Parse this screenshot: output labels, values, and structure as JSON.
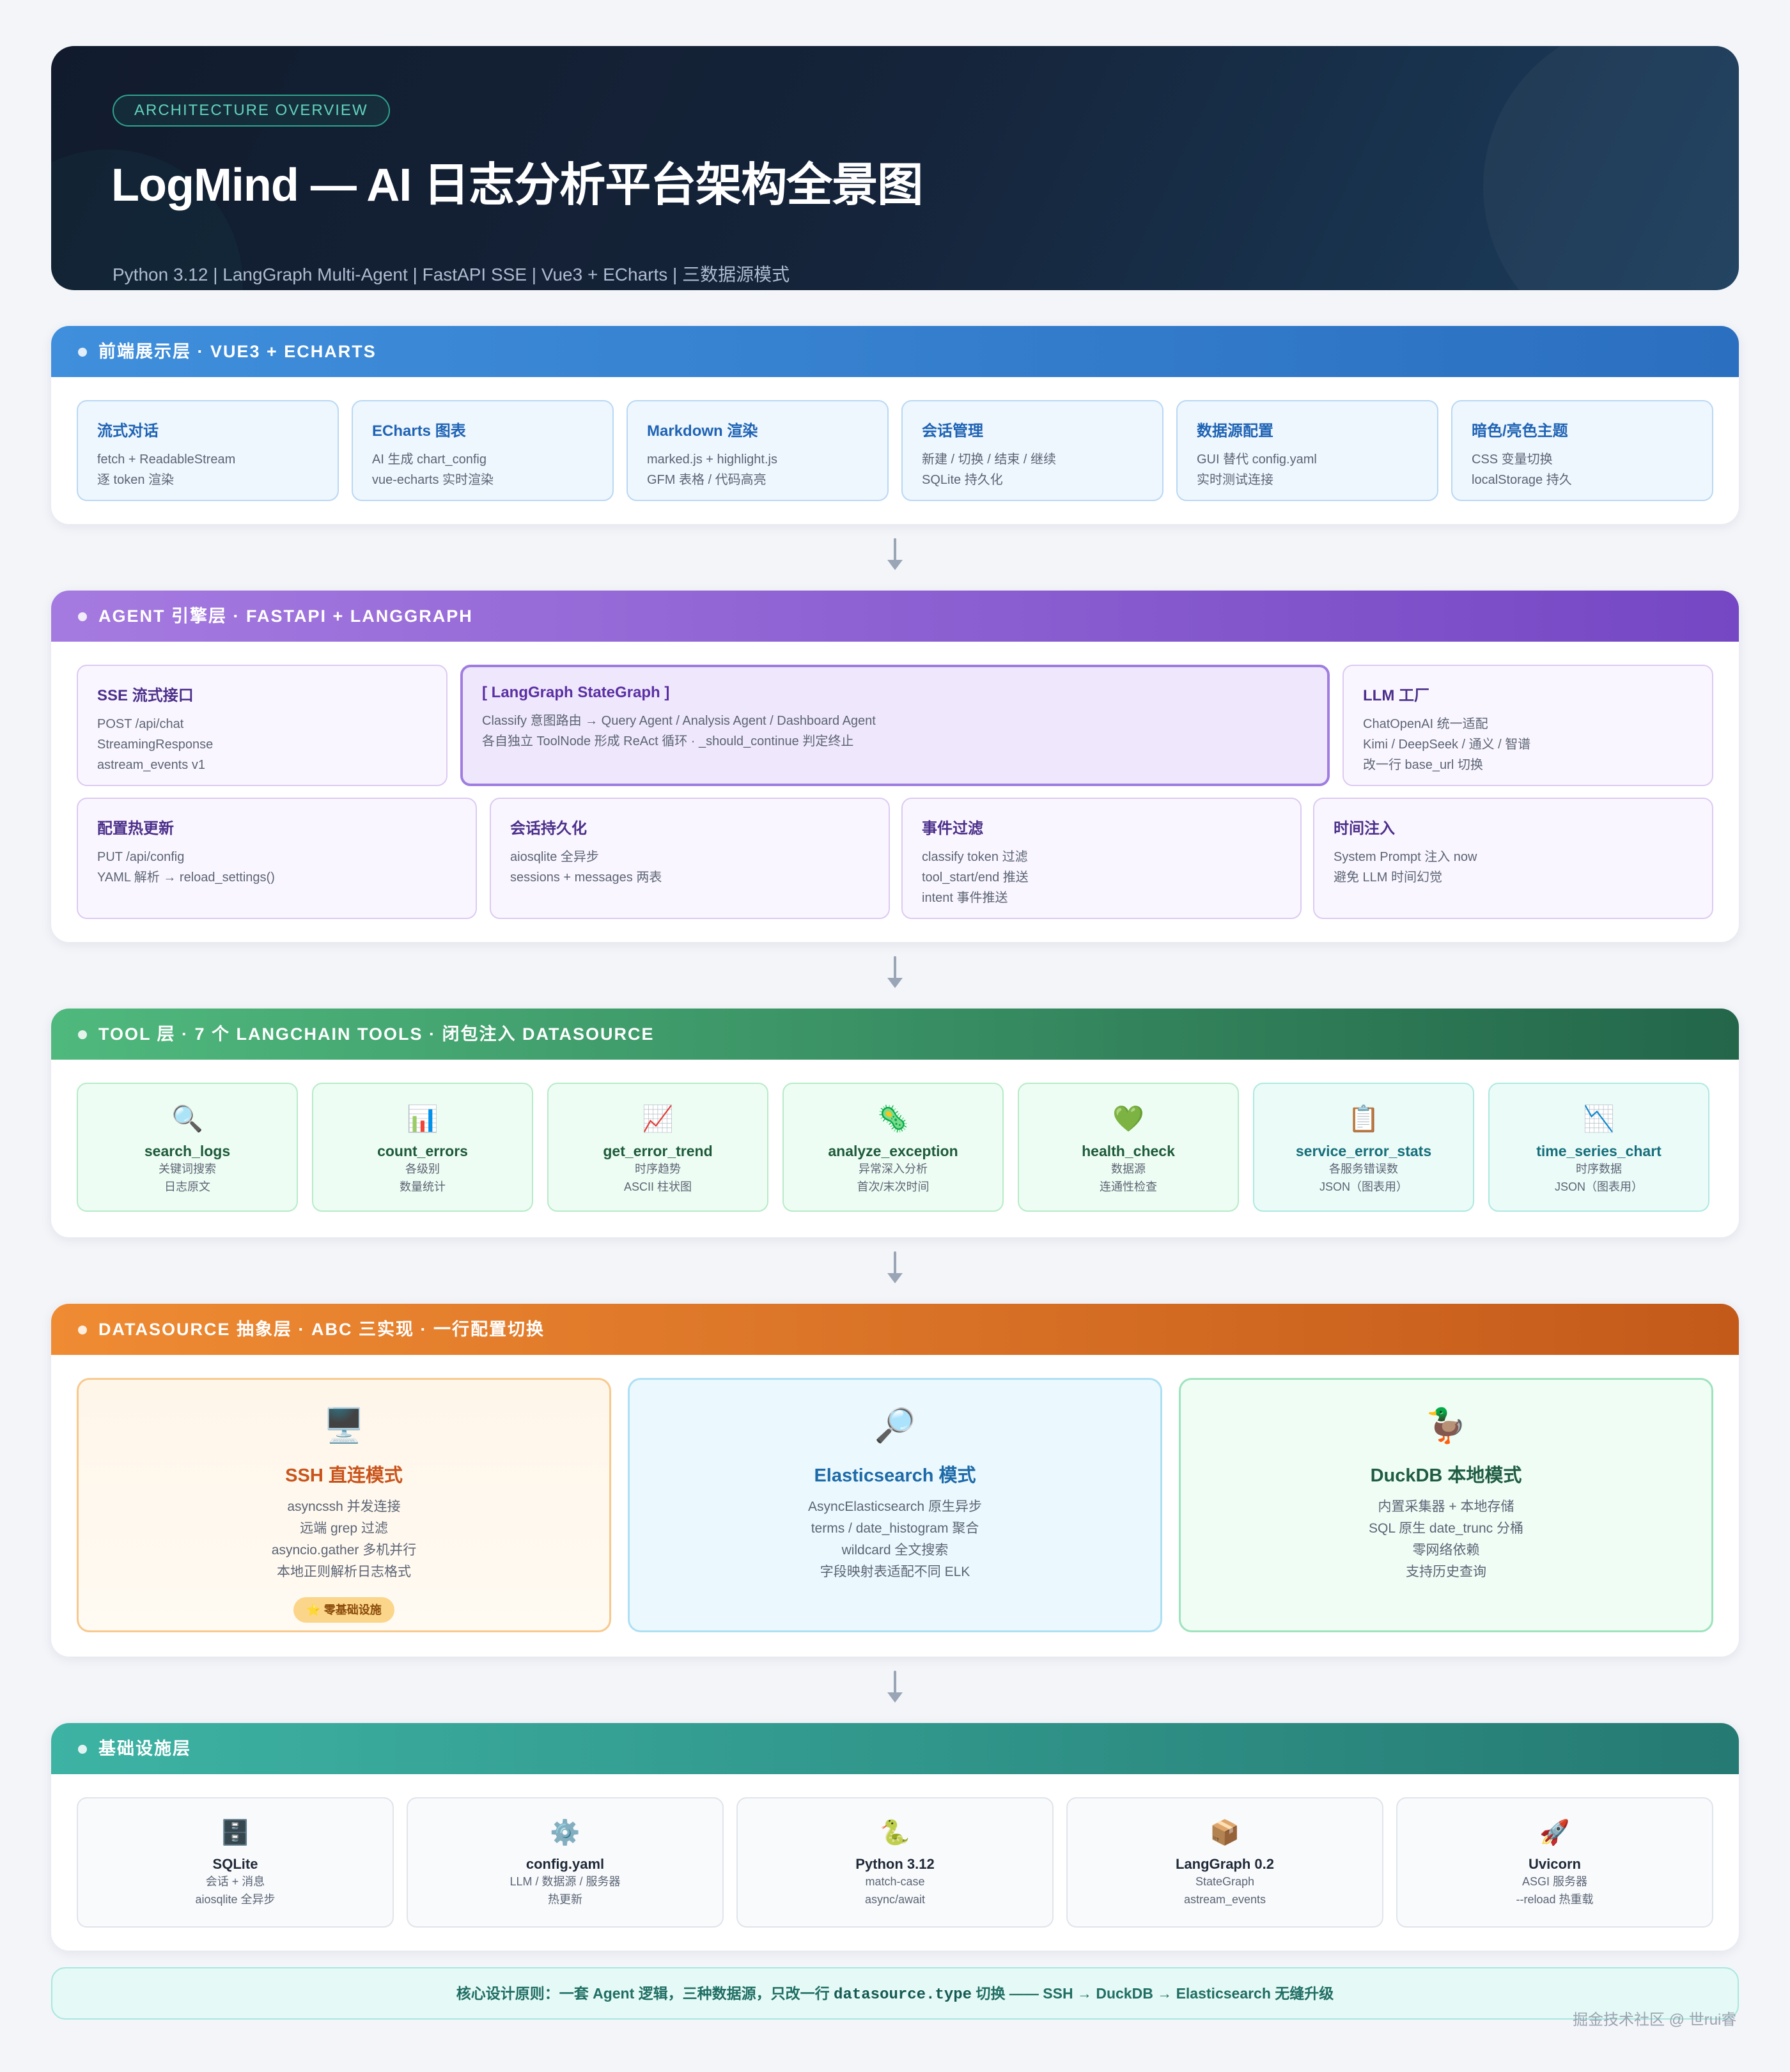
{
  "hero": {
    "badge": "ARCHITECTURE OVERVIEW",
    "title": "LogMind — AI 日志分析平台架构全景图",
    "subtitle": "Python 3.12  |  LangGraph Multi-Agent  |  FastAPI SSE  |  Vue3 + ECharts  |  三数据源模式"
  },
  "frontend": {
    "header": "前端展示层 · VUE3 + ECHARTS",
    "boxes": [
      {
        "title": "流式对话",
        "lines": [
          "fetch + ReadableStream",
          "逐 token 渲染"
        ]
      },
      {
        "title": "ECharts 图表",
        "lines": [
          "AI 生成 chart_config",
          "vue-echarts 实时渲染"
        ]
      },
      {
        "title": "Markdown 渲染",
        "lines": [
          "marked.js + highlight.js",
          "GFM 表格 / 代码高亮"
        ]
      },
      {
        "title": "会话管理",
        "lines": [
          "新建 / 切换 / 结束 / 继续",
          "SQLite 持久化"
        ]
      },
      {
        "title": "数据源配置",
        "lines": [
          "GUI 替代 config.yaml",
          "实时测试连接"
        ]
      },
      {
        "title": "暗色/亮色主题",
        "lines": [
          "CSS 变量切换",
          "localStorage 持久"
        ]
      }
    ]
  },
  "agent": {
    "header": "AGENT 引擎层 · FASTAPI + LANGGRAPH",
    "top": [
      {
        "title": "SSE 流式接口",
        "lines": [
          "POST /api/chat",
          "StreamingResponse",
          "astream_events v1"
        ]
      },
      {
        "title": "[ LangGraph StateGraph ]",
        "lines": [
          "Classify 意图路由 → Query Agent / Analysis Agent / Dashboard Agent",
          "各自独立 ToolNode 形成 ReAct 循环 · _should_continue 判定终止"
        ]
      },
      {
        "title": "LLM 工厂",
        "lines": [
          "ChatOpenAI 统一适配",
          "Kimi / DeepSeek / 通义 / 智谱",
          "改一行 base_url 切换"
        ]
      }
    ],
    "bottom": [
      {
        "title": "配置热更新",
        "lines": [
          "PUT /api/config",
          "YAML 解析 → reload_settings()"
        ]
      },
      {
        "title": "会话持久化",
        "lines": [
          "aiosqlite 全异步",
          "sessions + messages 两表"
        ]
      },
      {
        "title": "事件过滤",
        "lines": [
          "classify token 过滤",
          "tool_start/end 推送",
          "intent 事件推送"
        ]
      },
      {
        "title": "时间注入",
        "lines": [
          "System Prompt 注入 now",
          "避免 LLM 时间幻觉"
        ]
      }
    ]
  },
  "tools": {
    "header": "TOOL 层 · 7 个 LANGCHAIN TOOLS · 闭包注入 DATASOURCE",
    "items": [
      {
        "icon": "🔍",
        "icon_name": "magnifier-icon",
        "name": "search_logs",
        "lines": [
          "关键词搜索",
          "日志原文"
        ]
      },
      {
        "icon": "📊",
        "icon_name": "bar-chart-icon",
        "name": "count_errors",
        "lines": [
          "各级别",
          "数量统计"
        ]
      },
      {
        "icon": "📈",
        "icon_name": "trend-up-icon",
        "name": "get_error_trend",
        "lines": [
          "时序趋势",
          "ASCII 柱状图"
        ]
      },
      {
        "icon": "🦠",
        "icon_name": "microbe-icon",
        "name": "analyze_exception",
        "lines": [
          "异常深入分析",
          "首次/末次时间"
        ]
      },
      {
        "icon": "💚",
        "icon_name": "green-heart-icon",
        "name": "health_check",
        "lines": [
          "数据源",
          "连通性检查"
        ]
      },
      {
        "icon": "📋",
        "icon_name": "clipboard-icon",
        "name": "service_error_stats",
        "lines": [
          "各服务错误数",
          "JSON（图表用）"
        ]
      },
      {
        "icon": "📉",
        "icon_name": "trend-down-icon",
        "name": "time_series_chart",
        "lines": [
          "时序数据",
          "JSON（图表用）"
        ]
      }
    ]
  },
  "datasource": {
    "header": "DATASOURCE 抽象层 · ABC 三实现 · 一行配置切换",
    "items": [
      {
        "icon": "🖥️",
        "icon_name": "desktop-computer-icon",
        "name": "SSH 直连模式",
        "lines": [
          "asyncssh 并发连接",
          "远端 grep 过滤",
          "asyncio.gather 多机并行",
          "本地正则解析日志格式"
        ],
        "badge": "⭐ 零基础设施"
      },
      {
        "icon": "🔎",
        "icon_name": "magnifier-icon",
        "name": "Elasticsearch 模式",
        "lines": [
          "AsyncElasticsearch 原生异步",
          "terms / date_histogram 聚合",
          "wildcard 全文搜索",
          "字段映射表适配不同 ELK"
        ]
      },
      {
        "icon": "🦆",
        "icon_name": "duck-icon",
        "name": "DuckDB 本地模式",
        "lines": [
          "内置采集器 + 本地存储",
          "SQL 原生 date_trunc 分桶",
          "零网络依赖",
          "支持历史查询"
        ]
      }
    ]
  },
  "infra": {
    "header": "基础设施层",
    "items": [
      {
        "icon": "🗄️",
        "icon_name": "file-cabinet-icon",
        "name": "SQLite",
        "lines": [
          "会话 + 消息",
          "aiosqlite 全异步"
        ]
      },
      {
        "icon": "⚙️",
        "icon_name": "gear-icon",
        "name": "config.yaml",
        "lines": [
          "LLM / 数据源 / 服务器",
          "热更新"
        ]
      },
      {
        "icon": "🐍",
        "icon_name": "snake-icon",
        "name": "Python 3.12",
        "lines": [
          "match-case",
          "async/await"
        ]
      },
      {
        "icon": "📦",
        "icon_name": "package-icon",
        "name": "LangGraph 0.2",
        "lines": [
          "StateGraph",
          "astream_events"
        ]
      },
      {
        "icon": "🚀",
        "icon_name": "rocket-icon",
        "name": "Uvicorn",
        "lines": [
          "ASGI 服务器",
          "--reload 热重载"
        ]
      }
    ]
  },
  "principle": {
    "prefix": "核心设计原则：一套 Agent 逻辑，三种数据源，只改一行 ",
    "code": "datasource.type",
    "suffix": " 切换 —— SSH → DuckDB → Elasticsearch 无缝升级"
  },
  "watermark": "掘金技术社区 @ 世rui睿"
}
